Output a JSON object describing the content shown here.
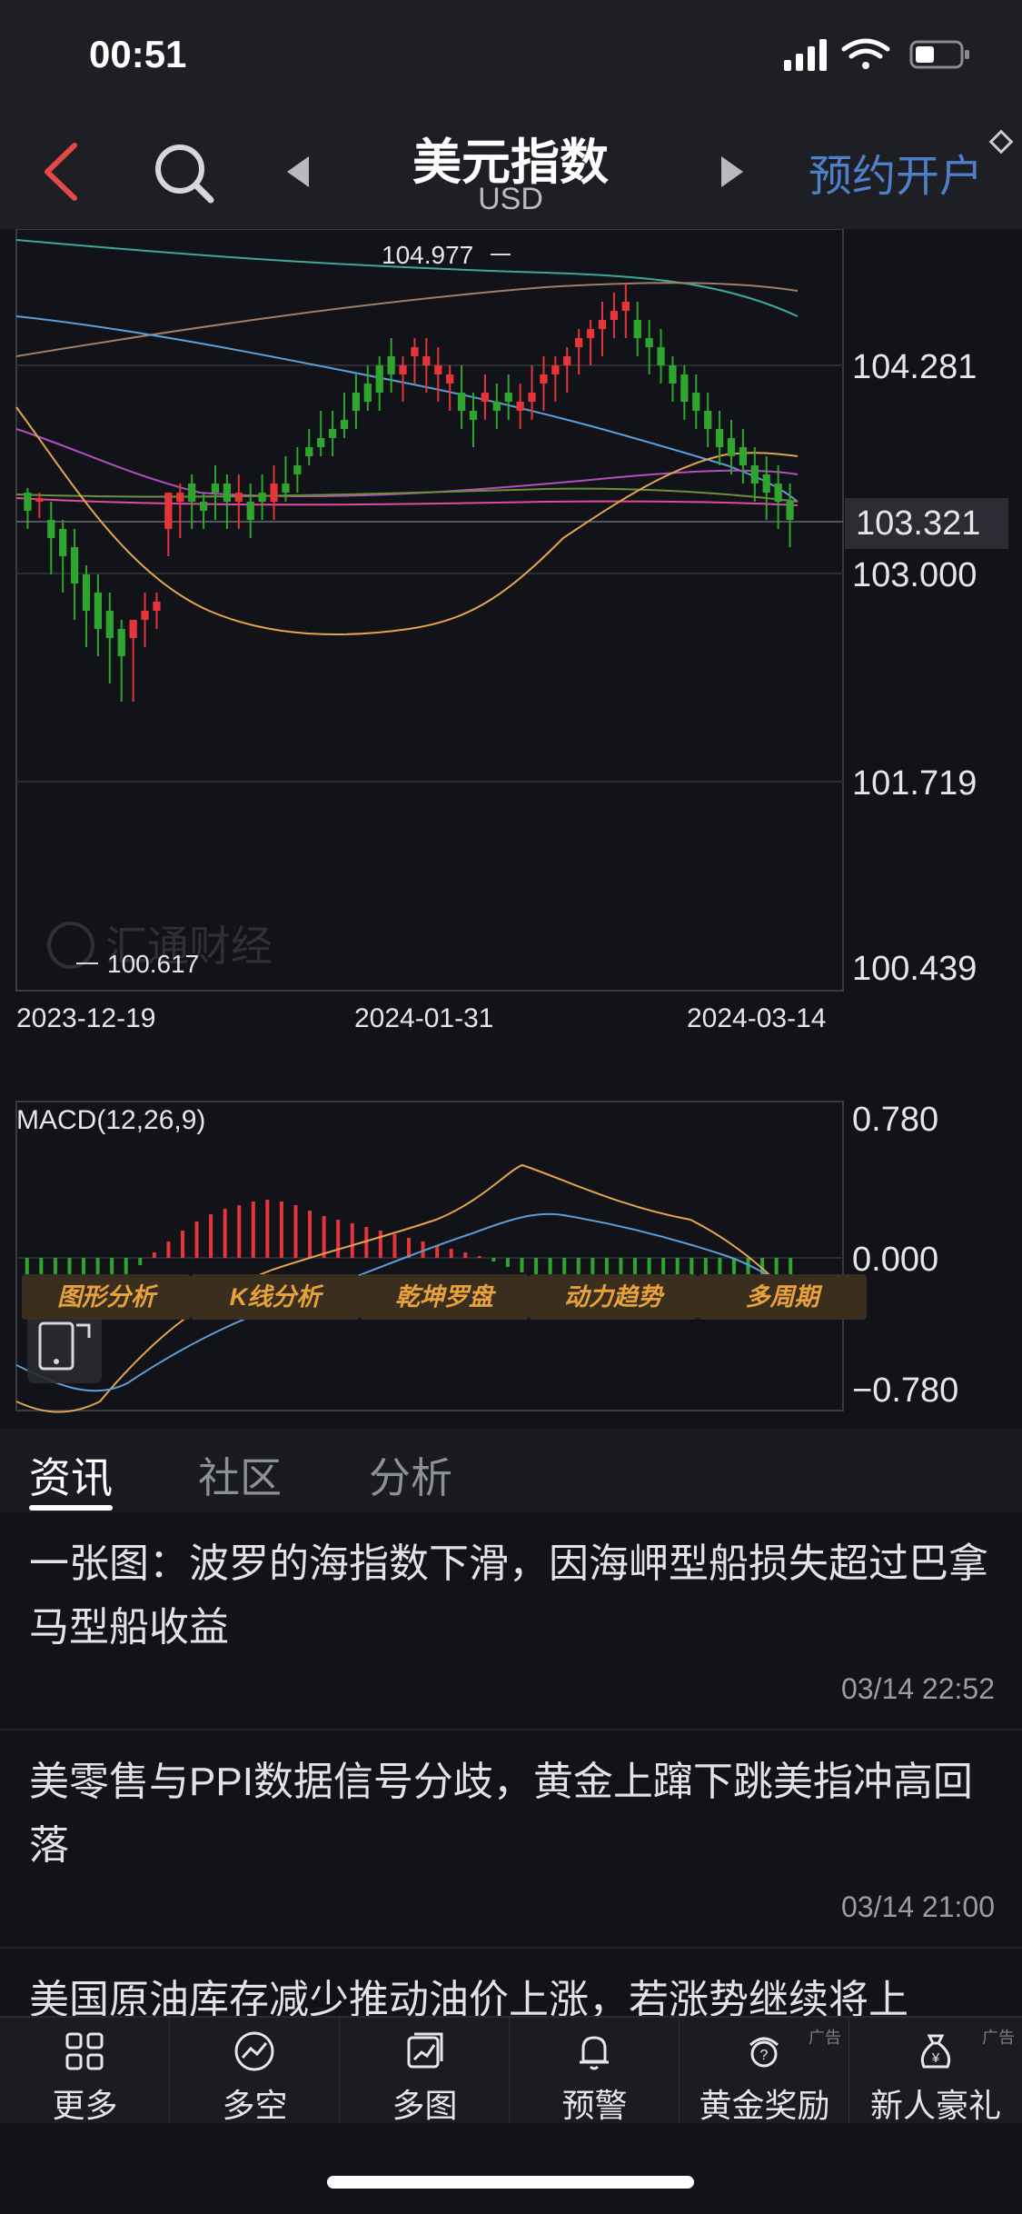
{
  "status": {
    "time": "00:51"
  },
  "nav": {
    "title": "美元指数",
    "subtitle": "USD",
    "reserve_label": "预约开户"
  },
  "chart": {
    "price_labels": {
      "high": "104.977",
      "low": "100.617"
    },
    "y_ticks": [
      "104.281",
      "103.000",
      "101.719",
      "100.439"
    ],
    "current_price": "103.321",
    "x_ticks": [
      "2023-12-19",
      "2024-01-31",
      "2024-03-14"
    ],
    "watermark": "汇通财经",
    "macd_label": "MACD(12,26,9)",
    "macd_ticks": [
      "0.780",
      "0.000",
      "−0.780"
    ],
    "colors": {
      "up": "#e5353b",
      "down": "#2fa52f",
      "accent": "#e8a13b"
    }
  },
  "tools": [
    "图形分析",
    "K线分析",
    "乾坤罗盘",
    "动力趋势",
    "多周期"
  ],
  "tabs": [
    "资讯",
    "社区",
    "分析"
  ],
  "news": [
    {
      "title": "一张图：波罗的海指数下滑，因海岬型船损失超过巴拿马型船收益",
      "time": "03/14 22:52"
    },
    {
      "title": "美零售与PPI数据信号分歧，黄金上蹿下跳美指冲高回落",
      "time": "03/14 21:00"
    },
    {
      "title": "美国原油库存减少推动油价上涨，若涨势继续将上",
      "time": ""
    }
  ],
  "bottom_nav": [
    {
      "label": "更多",
      "icon": "grid-icon"
    },
    {
      "label": "多空",
      "icon": "trend-circle-icon"
    },
    {
      "label": "多图",
      "icon": "multi-chart-icon"
    },
    {
      "label": "预警",
      "icon": "bell-icon"
    },
    {
      "label": "黄金奖励",
      "icon": "gift-icon",
      "ad": "广告"
    },
    {
      "label": "新人豪礼",
      "icon": "yen-bag-icon",
      "ad": "广告"
    }
  ]
}
